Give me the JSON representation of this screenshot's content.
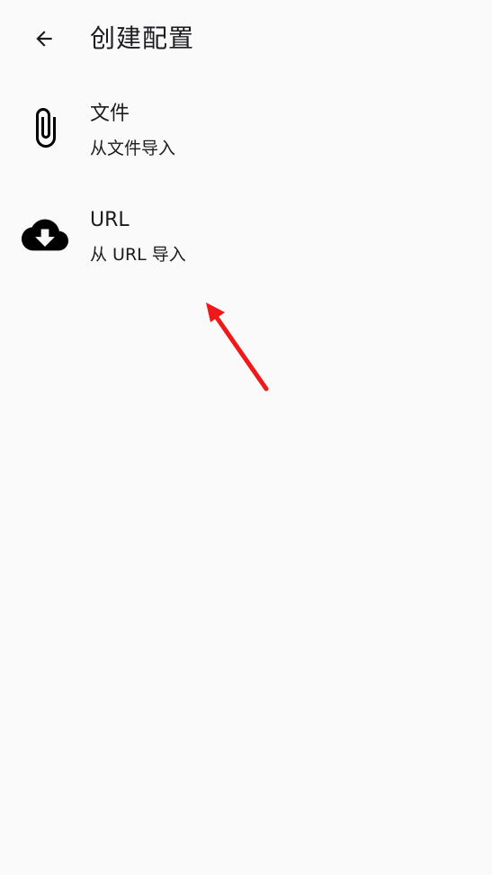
{
  "header": {
    "title": "创建配置",
    "back_icon": "arrow-back-icon"
  },
  "items": [
    {
      "icon": "paperclip-icon",
      "title": "文件",
      "subtitle": "从文件导入"
    },
    {
      "icon": "cloud-download-icon",
      "title": "URL",
      "subtitle": "从 URL 导入"
    }
  ],
  "annotation": {
    "type": "red-arrow",
    "color": "#f01818"
  }
}
